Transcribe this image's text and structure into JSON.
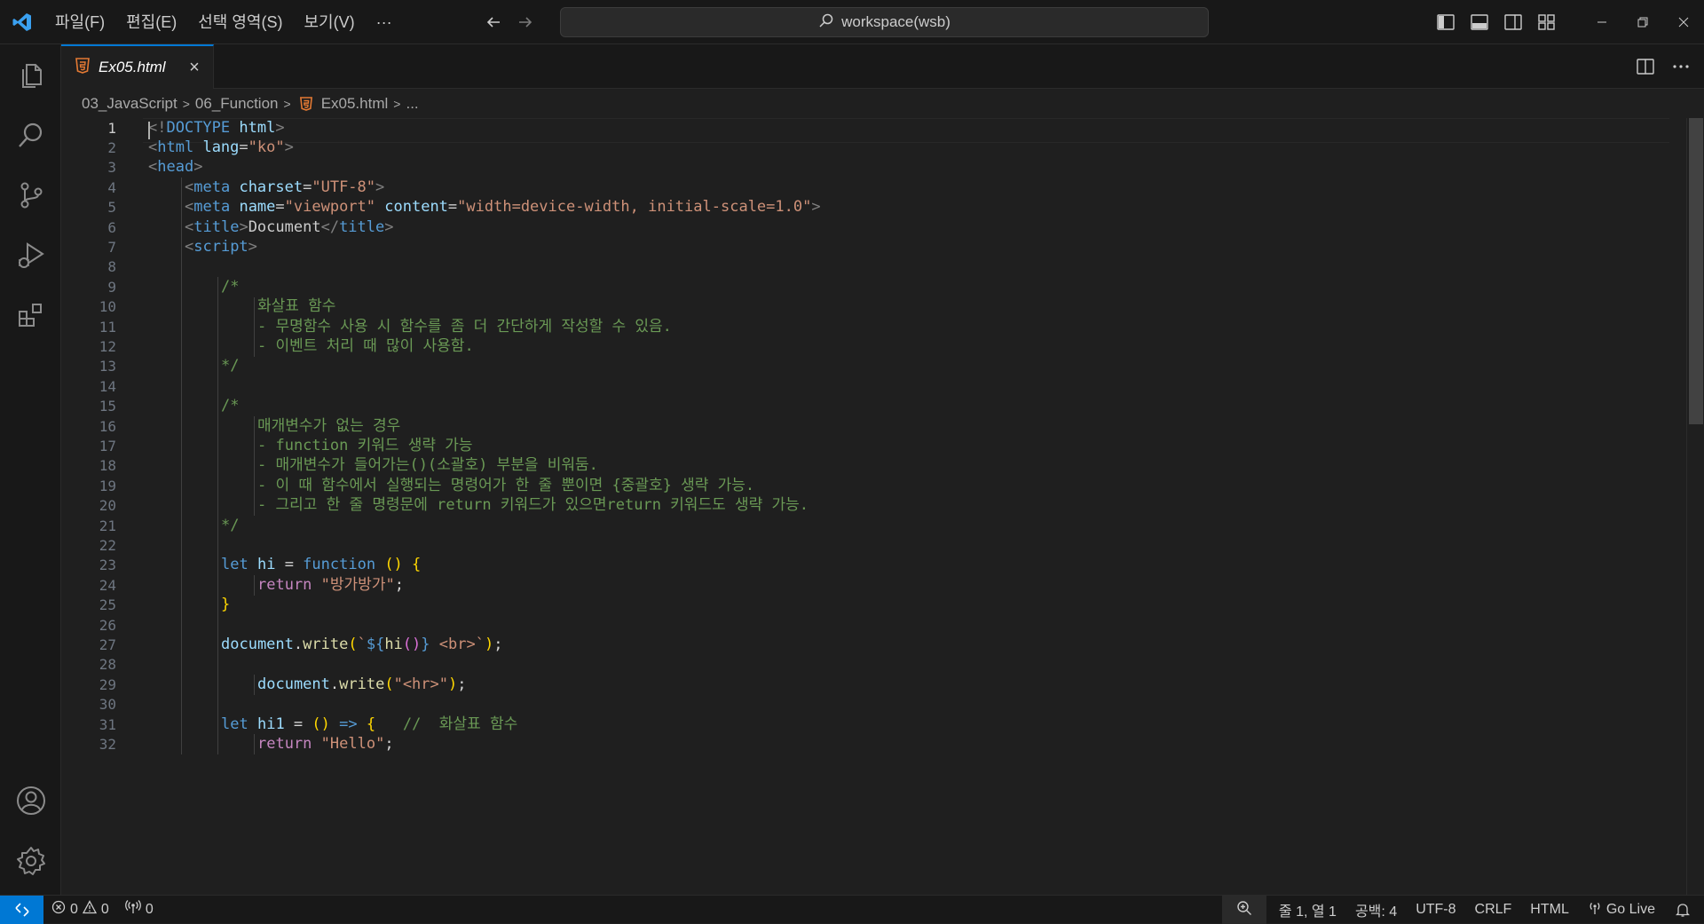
{
  "titlebar": {
    "menu": [
      "파일(F)",
      "편집(E)",
      "선택 영역(S)",
      "보기(V)",
      "···"
    ],
    "search_text": "workspace(wsb)"
  },
  "tab": {
    "label": "Ex05.html"
  },
  "breadcrumb": {
    "folder1": "03_JavaScript",
    "folder2": "06_Function",
    "file": "Ex05.html",
    "more": "..."
  },
  "editor": {
    "active_line": 1,
    "line_numbers": [
      "1",
      "2",
      "3",
      "4",
      "5",
      "6",
      "7",
      "8",
      "9",
      "10",
      "11",
      "12",
      "13",
      "14",
      "15",
      "16",
      "17",
      "18",
      "19",
      "20",
      "21",
      "22",
      "23",
      "24",
      "25",
      "26",
      "27",
      "28",
      "29",
      "30",
      "31",
      "32"
    ],
    "lines": [
      {
        "indent": 0,
        "tokens": [
          [
            "<!",
            "br"
          ],
          [
            "DOCTYPE",
            "tag"
          ],
          [
            " ",
            "txt"
          ],
          [
            "html",
            "attr"
          ],
          [
            ">",
            "br"
          ]
        ]
      },
      {
        "indent": 0,
        "tokens": [
          [
            "<",
            "br"
          ],
          [
            "html",
            "tag"
          ],
          [
            " ",
            "txt"
          ],
          [
            "lang",
            "attr"
          ],
          [
            "=",
            "txt"
          ],
          [
            "\"ko\"",
            "str"
          ],
          [
            ">",
            "br"
          ]
        ]
      },
      {
        "indent": 0,
        "tokens": [
          [
            "<",
            "br"
          ],
          [
            "head",
            "tag"
          ],
          [
            ">",
            "br"
          ]
        ]
      },
      {
        "indent": 4,
        "tokens": [
          [
            "<",
            "br"
          ],
          [
            "meta",
            "tag"
          ],
          [
            " ",
            "txt"
          ],
          [
            "charset",
            "attr"
          ],
          [
            "=",
            "txt"
          ],
          [
            "\"UTF-8\"",
            "str"
          ],
          [
            ">",
            "br"
          ]
        ]
      },
      {
        "indent": 4,
        "tokens": [
          [
            "<",
            "br"
          ],
          [
            "meta",
            "tag"
          ],
          [
            " ",
            "txt"
          ],
          [
            "name",
            "attr"
          ],
          [
            "=",
            "txt"
          ],
          [
            "\"viewport\"",
            "str"
          ],
          [
            " ",
            "txt"
          ],
          [
            "content",
            "attr"
          ],
          [
            "=",
            "txt"
          ],
          [
            "\"width=device-width, initial-scale=1.0\"",
            "str"
          ],
          [
            ">",
            "br"
          ]
        ]
      },
      {
        "indent": 4,
        "tokens": [
          [
            "<",
            "br"
          ],
          [
            "title",
            "tag"
          ],
          [
            ">",
            "br"
          ],
          [
            "Document",
            "txt"
          ],
          [
            "</",
            "br"
          ],
          [
            "title",
            "tag"
          ],
          [
            ">",
            "br"
          ]
        ]
      },
      {
        "indent": 4,
        "tokens": [
          [
            "<",
            "br"
          ],
          [
            "script",
            "tag"
          ],
          [
            ">",
            "br"
          ]
        ]
      },
      {
        "indent": 0,
        "tokens": []
      },
      {
        "indent": 8,
        "tokens": [
          [
            "/*",
            "com"
          ]
        ]
      },
      {
        "indent": 12,
        "tokens": [
          [
            "화살표 함수",
            "com"
          ]
        ]
      },
      {
        "indent": 12,
        "tokens": [
          [
            "- 무명함수 사용 시 함수를 좀 더 간단하게 작성할 수 있음.",
            "com"
          ]
        ]
      },
      {
        "indent": 12,
        "tokens": [
          [
            "- 이벤트 처리 때 많이 사용함.",
            "com"
          ]
        ]
      },
      {
        "indent": 8,
        "tokens": [
          [
            "*/",
            "com"
          ]
        ]
      },
      {
        "indent": 0,
        "tokens": []
      },
      {
        "indent": 8,
        "tokens": [
          [
            "/*",
            "com"
          ]
        ]
      },
      {
        "indent": 12,
        "tokens": [
          [
            "매개변수가 없는 경우",
            "com"
          ]
        ]
      },
      {
        "indent": 12,
        "tokens": [
          [
            "- function 키워드 생략 가능",
            "com"
          ]
        ]
      },
      {
        "indent": 12,
        "tokens": [
          [
            "- 매개변수가 들어가는()(소괄호) 부분을 비워둠.",
            "com"
          ]
        ]
      },
      {
        "indent": 12,
        "tokens": [
          [
            "- 이 때 함수에서 실행되는 명령어가 한 줄 뿐이면 {중괄호} 생략 가능.",
            "com"
          ]
        ]
      },
      {
        "indent": 12,
        "tokens": [
          [
            "- 그리고 한 줄 명령문에 return 키워드가 있으면return 키워드도 생략 가능.",
            "com"
          ]
        ]
      },
      {
        "indent": 8,
        "tokens": [
          [
            "*/",
            "com"
          ]
        ]
      },
      {
        "indent": 0,
        "tokens": []
      },
      {
        "indent": 8,
        "tokens": [
          [
            "let",
            "kw"
          ],
          [
            " ",
            "txt"
          ],
          [
            "hi",
            "var"
          ],
          [
            " = ",
            "op"
          ],
          [
            "function",
            "kw"
          ],
          [
            " ",
            "txt"
          ],
          [
            "()",
            "p1"
          ],
          [
            " ",
            "txt"
          ],
          [
            "{",
            "p1"
          ]
        ]
      },
      {
        "indent": 12,
        "tokens": [
          [
            "return",
            "ctl"
          ],
          [
            " ",
            "txt"
          ],
          [
            "\"방가방가\"",
            "str"
          ],
          [
            ";",
            "op"
          ]
        ]
      },
      {
        "indent": 8,
        "tokens": [
          [
            "}",
            "p1"
          ]
        ]
      },
      {
        "indent": 0,
        "tokens": []
      },
      {
        "indent": 8,
        "tokens": [
          [
            "document",
            "var"
          ],
          [
            ".",
            "op"
          ],
          [
            "write",
            "fn"
          ],
          [
            "(",
            "p1"
          ],
          [
            "`",
            "str"
          ],
          [
            "${",
            "kw"
          ],
          [
            "hi",
            "fn"
          ],
          [
            "()",
            "p2"
          ],
          [
            "}",
            "kw"
          ],
          [
            " <br>`",
            "str"
          ],
          [
            ")",
            "p1"
          ],
          [
            ";",
            "op"
          ]
        ]
      },
      {
        "indent": 0,
        "tokens": []
      },
      {
        "indent": 12,
        "tokens": [
          [
            "document",
            "var"
          ],
          [
            ".",
            "op"
          ],
          [
            "write",
            "fn"
          ],
          [
            "(",
            "p1"
          ],
          [
            "\"<hr>\"",
            "str"
          ],
          [
            ")",
            "p1"
          ],
          [
            ";",
            "op"
          ]
        ]
      },
      {
        "indent": 0,
        "tokens": []
      },
      {
        "indent": 8,
        "tokens": [
          [
            "let",
            "kw"
          ],
          [
            " ",
            "txt"
          ],
          [
            "hi1",
            "var"
          ],
          [
            " = ",
            "op"
          ],
          [
            "()",
            "p1"
          ],
          [
            " ",
            "txt"
          ],
          [
            "=>",
            "kw"
          ],
          [
            " ",
            "txt"
          ],
          [
            "{",
            "p1"
          ],
          [
            "   ",
            "txt"
          ],
          [
            "//  화살표 함수",
            "com"
          ]
        ]
      },
      {
        "indent": 12,
        "tokens": [
          [
            "return",
            "ctl"
          ],
          [
            " ",
            "txt"
          ],
          [
            "\"Hello\"",
            "str"
          ],
          [
            ";",
            "op"
          ]
        ]
      }
    ]
  },
  "statusbar": {
    "errors": "0",
    "warnings": "0",
    "ports": "0",
    "position": "줄 1, 열 1",
    "spaces": "공백: 4",
    "encoding": "UTF-8",
    "eol": "CRLF",
    "language": "HTML",
    "golive": "Go Live"
  },
  "colors": {
    "accent": "#0078d4",
    "html_icon": "#e37933",
    "background": "#1f1f1f",
    "comment": "#6a9955",
    "string": "#ce9178"
  }
}
